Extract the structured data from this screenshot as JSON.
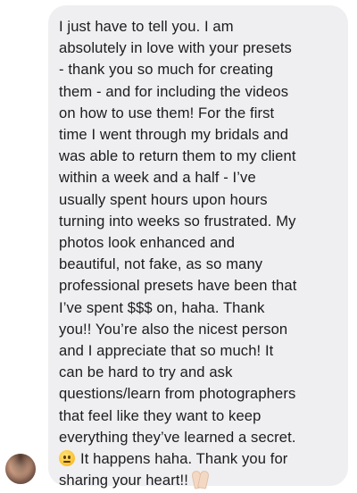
{
  "conversation": {
    "message": {
      "lines": [
        "I just have to tell you. I am",
        "absolutely in love with your presets",
        "- thank you so much for creating",
        "them - and for including the videos",
        "on how to use them! For the first",
        "time I went through my bridals and",
        "was able to return them to my client",
        "within a week and a half - I’ve",
        "usually spent hours upon hours",
        "turning into weeks so frustrated. My",
        "photos look enhanced and",
        "beautiful, not fake, as so many",
        "professional presets have been that",
        "I’ve spent $$$ on, haha. Thank",
        "you!! You’re also the nicest person",
        "and I appreciate that so much! It",
        "can be hard to try and ask",
        "questions/learn from photographers",
        "that feel like they want to keep",
        "everything they’ve learned a secret."
      ],
      "line_with_emoji": "It happens haha. Thank you for",
      "last_line": "sharing your heart!!",
      "emoji_1": "neutral-face-emoji",
      "emoji_2": "folded-hands-emoji"
    },
    "colors": {
      "bubble_background": "#efeff1",
      "text": "#1c1c1e"
    }
  }
}
